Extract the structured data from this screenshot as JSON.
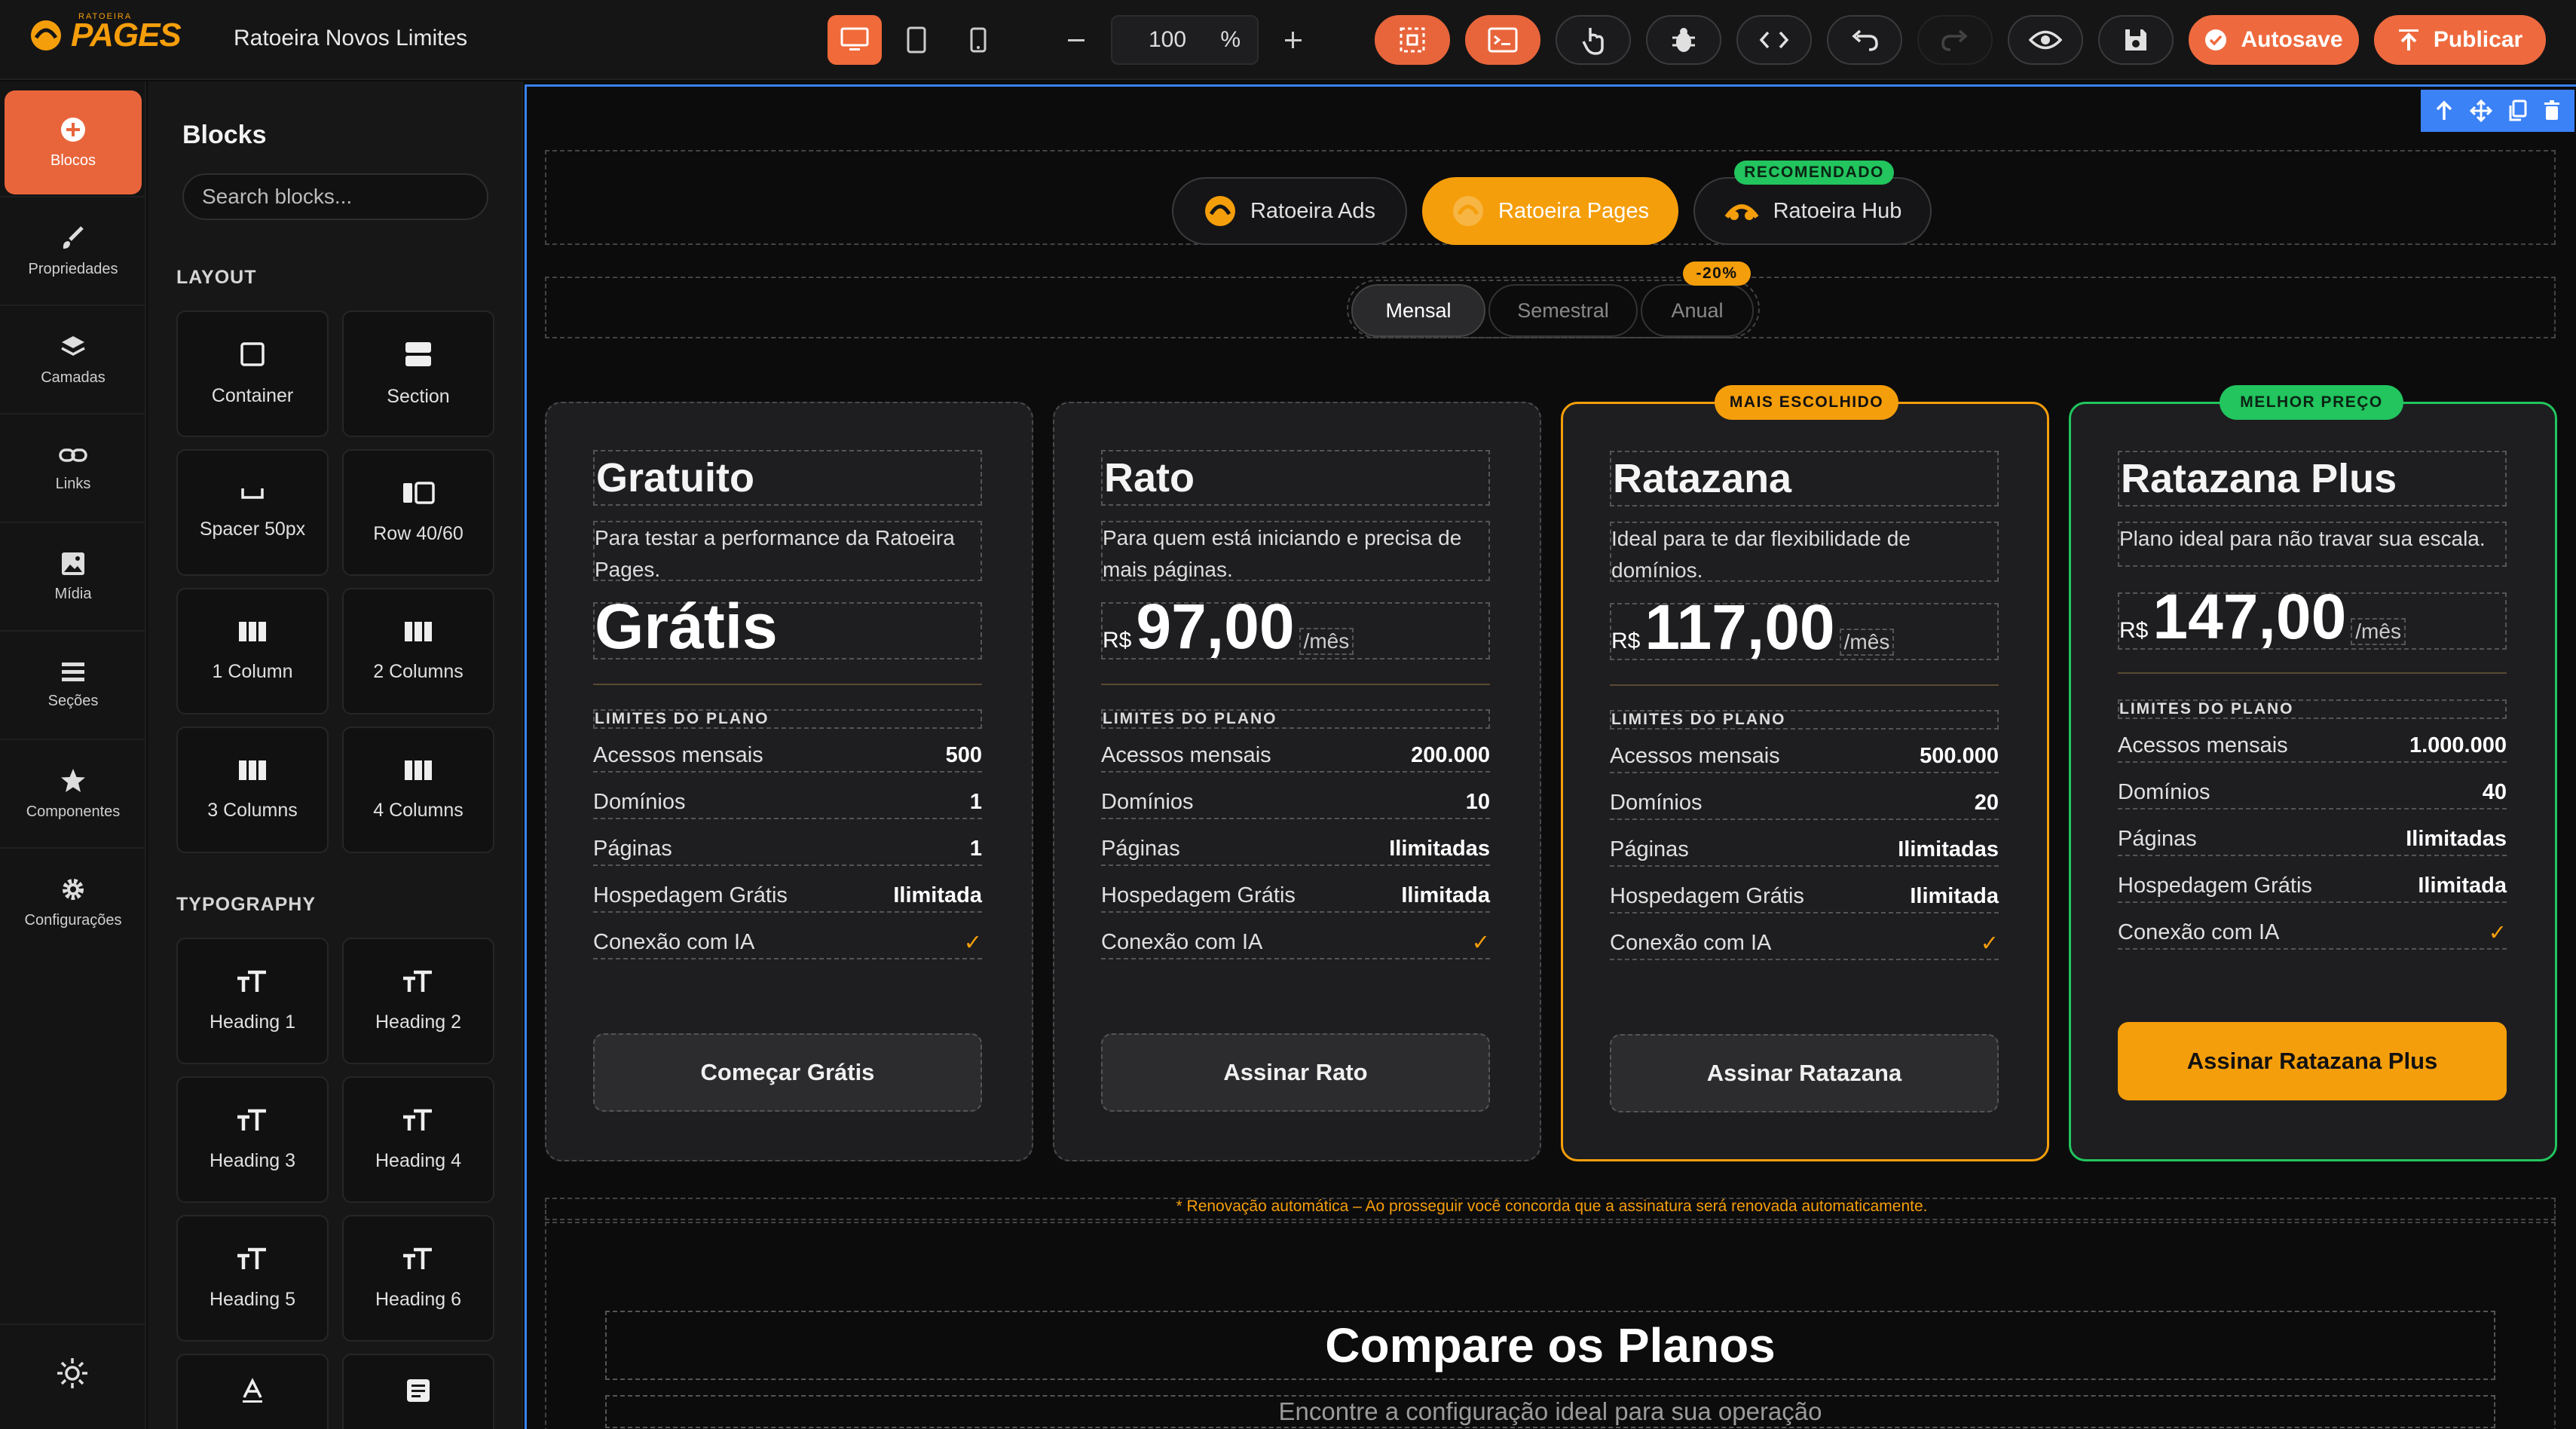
{
  "app": {
    "logo_text": "PAGES",
    "logo_sub": "RATOEIRA",
    "project_title": "Ratoeira Novos Limites"
  },
  "toolbar": {
    "zoom_value": "100",
    "zoom_unit": "%",
    "autosave_label": "Autosave",
    "publish_label": "Publicar",
    "active_device": "desktop"
  },
  "rail": {
    "items": [
      {
        "label": "Blocos",
        "icon": "plus-circle-icon"
      },
      {
        "label": "Propriedades",
        "icon": "brush-icon"
      },
      {
        "label": "Camadas",
        "icon": "layers-icon"
      },
      {
        "label": "Links",
        "icon": "link-icon"
      },
      {
        "label": "Mídia",
        "icon": "image-icon"
      },
      {
        "label": "Seções",
        "icon": "sections-icon"
      },
      {
        "label": "Componentes",
        "icon": "star-icon"
      },
      {
        "label": "Configurações",
        "icon": "gear-icon"
      }
    ]
  },
  "panel": {
    "title": "Blocks",
    "search_placeholder": "Search blocks...",
    "layout_title": "LAYOUT",
    "layout_blocks": [
      "Container",
      "Section",
      "Spacer 50px",
      "Row 40/60",
      "1 Column",
      "2 Columns",
      "3 Columns",
      "4 Columns"
    ],
    "typography_title": "TYPOGRAPHY",
    "typography_blocks": [
      "Heading 1",
      "Heading 2",
      "Heading 3",
      "Heading 4",
      "Heading 5",
      "Heading 6"
    ]
  },
  "page": {
    "products": [
      {
        "label": "Ratoeira Ads"
      },
      {
        "label": "Ratoeira Pages",
        "active": true
      },
      {
        "label": "Ratoeira Hub",
        "badge": "RECOMENDADO"
      }
    ],
    "periods": [
      {
        "label": "Mensal",
        "active": true
      },
      {
        "label": "Semestral"
      },
      {
        "label": "Anual",
        "badge": "-20%"
      }
    ],
    "limits_title": "LIMITES DO PLANO",
    "row_labels": [
      "Acessos mensais",
      "Domínios",
      "Páginas",
      "Hospedagem Grátis",
      "Conexão com IA"
    ],
    "plans": [
      {
        "name": "Gratuito",
        "desc": "Para testar a performance da Ratoeira Pages.",
        "currency": "",
        "price": "Grátis",
        "period": "",
        "values": [
          "500",
          "1",
          "1",
          "Ilimitada",
          "✓"
        ],
        "cta": "Começar Grátis"
      },
      {
        "name": "Rato",
        "desc": "Para quem está iniciando e precisa de mais páginas.",
        "currency": "R$",
        "price": "97,00",
        "period": "/mês",
        "values": [
          "200.000",
          "10",
          "Ilimitadas",
          "Ilimitada",
          "✓"
        ],
        "cta": "Assinar Rato"
      },
      {
        "name": "Ratazana",
        "desc": "Ideal para te dar flexibilidade de domínios.",
        "currency": "R$",
        "price": "117,00",
        "period": "/mês",
        "values": [
          "500.000",
          "20",
          "Ilimitadas",
          "Ilimitada",
          "✓"
        ],
        "cta": "Assinar Ratazana",
        "badge": "MAIS ESCOLHIDO"
      },
      {
        "name": "Ratazana Plus",
        "desc": "Plano ideal para não travar sua escala.",
        "currency": "R$",
        "price": "147,00",
        "period": "/mês",
        "values": [
          "1.000.000",
          "40",
          "Ilimitadas",
          "Ilimitada",
          "✓"
        ],
        "cta": "Assinar Ratazana Plus",
        "badge": "MELHOR PREÇO"
      }
    ],
    "notice": "* Renovação automática – Ao prosseguir você concorda que a assinatura será renovada automaticamente.",
    "compare_title": "Compare os Planos",
    "compare_subtitle": "Encontre a configuração ideal para sua operação"
  },
  "colors": {
    "accent": "#e8653b",
    "gold": "#f59e0b",
    "green": "#22c55e",
    "selection": "#3b82f6"
  }
}
